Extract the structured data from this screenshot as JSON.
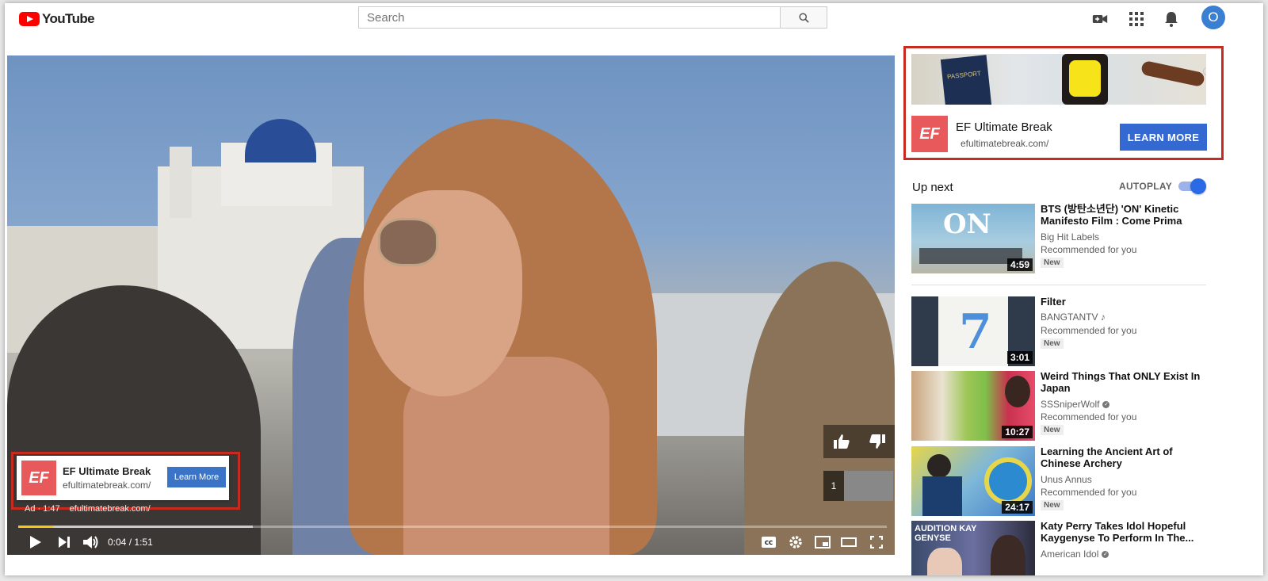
{
  "header": {
    "logo_text": "YouTube",
    "search_placeholder": "Search",
    "avatar_letter": "O"
  },
  "player": {
    "time_current": "0:04",
    "time_total": "1:51",
    "time_separator": "/",
    "progress_played": 0.04,
    "progress_buffered": 0.27,
    "queue_count": "1",
    "ad_overlay": {
      "logo_text": "EF",
      "title": "EF Ultimate Break",
      "url": "efultimatebreak.com/",
      "button_label": "Learn More",
      "ad_label": "Ad · 1:47",
      "ad_link": "efultimatebreak.com/"
    }
  },
  "sidebar_ad": {
    "passport_text": "PASSPORT",
    "logo_text": "EF",
    "title": "EF Ultimate Break",
    "url": "efultimatebreak.com/",
    "button_label": "LEARN MORE"
  },
  "upnext": {
    "heading": "Up next",
    "autoplay_label": "AUTOPLAY",
    "autoplay_on": true,
    "items": [
      {
        "title": "BTS (방탄소년단) 'ON' Kinetic Manifesto Film : Come Prima",
        "channel": "Big Hit Labels",
        "meta": "Recommended for you",
        "badge": "New",
        "duration": "4:59",
        "thumb_text": "ON"
      },
      {
        "title": "Filter",
        "channel": "BANGTANTV ♪",
        "meta": "Recommended for you",
        "badge": "New",
        "duration": "3:01",
        "thumb_text": "7"
      },
      {
        "title": "Weird Things That ONLY Exist In Japan",
        "channel": "SSSniperWolf",
        "meta": "Recommended for you",
        "badge": "New",
        "duration": "10:27"
      },
      {
        "title": "Learning the Ancient Art of Chinese Archery",
        "channel": "Unus Annus",
        "meta": "Recommended for you",
        "badge": "New",
        "duration": "24:17"
      },
      {
        "title": "Katy Perry Takes Idol Hopeful Kaygenyse To Perform In The...",
        "channel": "American Idol",
        "thumb_text": "AUDITION KAY GENYSE"
      }
    ]
  },
  "colors": {
    "youtube_red": "#ff0000",
    "ef_red": "#e8595b",
    "cta_blue": "#3469d1",
    "annotation_red": "#c72b1f",
    "progress_yellow": "#f5c518"
  }
}
